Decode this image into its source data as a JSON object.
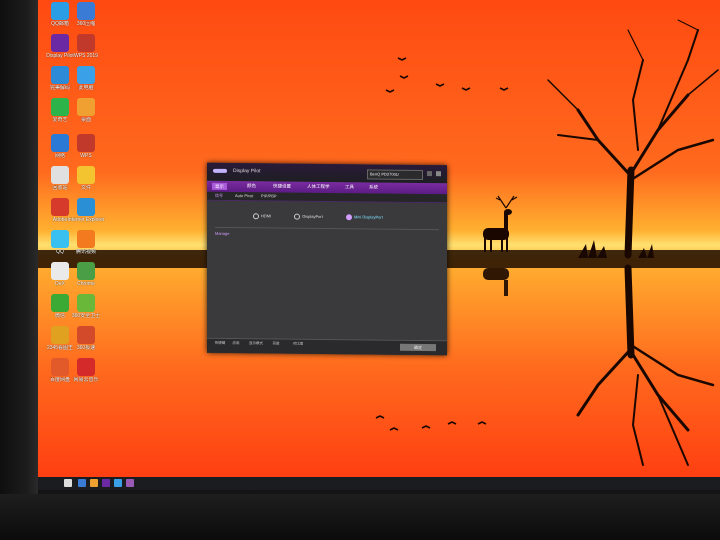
{
  "desktop": {
    "icons": [
      {
        "label": "QQ邮箱",
        "color": "#2a9de5"
      },
      {
        "label": "360压缩",
        "color": "#3a7bd5"
      },
      {
        "label": "Display Pilot",
        "color": "#6b2aa3"
      },
      {
        "label": "WPS 2019",
        "color": "#c0392b"
      },
      {
        "label": "完美解码",
        "color": "#2c8ad6"
      },
      {
        "label": "此电脑",
        "color": "#3aa0e8"
      },
      {
        "label": "爱奇艺",
        "color": "#2cb34a"
      },
      {
        "label": "桌面",
        "color": "#f0a030"
      },
      {
        "label": "网络",
        "color": "#2a7ad5"
      },
      {
        "label": "WPS",
        "color": "#c0392b"
      },
      {
        "label": "回收站",
        "color": "#e0e0e0"
      },
      {
        "label": "文件",
        "color": "#f4c430"
      },
      {
        "label": "Adobe",
        "color": "#d63a2a"
      },
      {
        "label": "Internet Explorer",
        "color": "#2a8fd5"
      },
      {
        "label": "QQ",
        "color": "#3ac0f0"
      },
      {
        "label": "腾讯视频",
        "color": "#f47a1f"
      },
      {
        "label": "DeX",
        "color": "#eaeaea"
      },
      {
        "label": "Chrome",
        "color": "#4a9f46"
      },
      {
        "label": "微信",
        "color": "#3aaa35"
      },
      {
        "label": "360安全卫士",
        "color": "#6ab83a"
      },
      {
        "label": "2345看图王",
        "color": "#e0a020"
      },
      {
        "label": "360极速",
        "color": "#d24a2a"
      },
      {
        "label": "百度网盘",
        "color": "#e25a2a"
      },
      {
        "label": "网易云音乐",
        "color": "#d42a2a"
      }
    ]
  },
  "window": {
    "title": "Display Pilot",
    "monitor": "BenQ PD2700U",
    "tabs": [
      "显示",
      "颜色",
      "快捷设置",
      "人体工程学",
      "工具",
      "系统"
    ],
    "subtabs": [
      "信号",
      "Auto Pivot",
      "PIP/PBP"
    ],
    "inputs": [
      "HDMI",
      "DisplayPort",
      "Mini DisplayPort"
    ],
    "selected_input": "Mini DisplayPort",
    "group_label": "Manage",
    "footer_buttons": [
      "快捷键",
      "应用",
      "显示模式",
      "亮度",
      "对比度"
    ],
    "apply_label": "确定"
  },
  "colors": {
    "sky_top": "#ff5a1a",
    "horizon": "#ffd24a",
    "accent": "#7a2ca0"
  }
}
